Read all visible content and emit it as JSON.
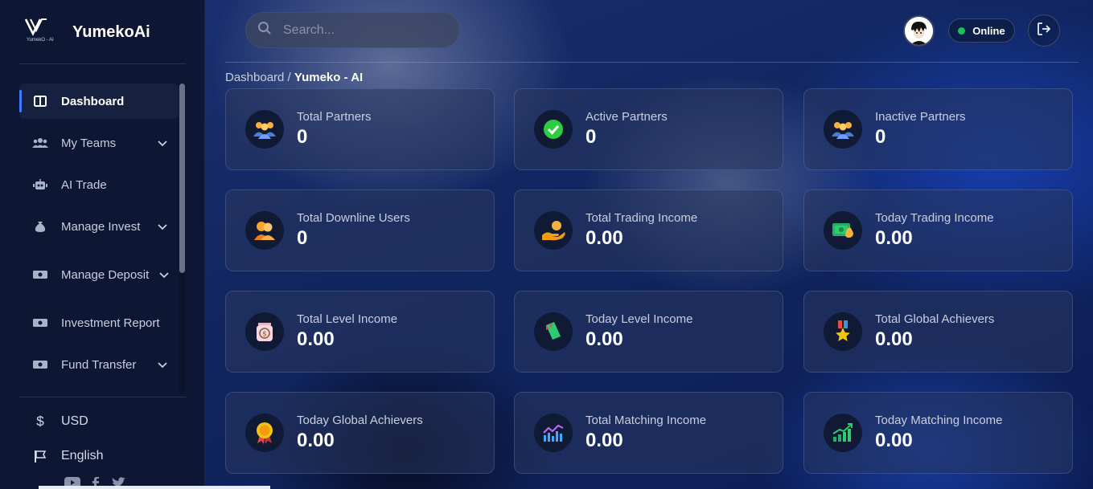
{
  "brand": {
    "name": "YumekoAi",
    "logo_subtext": "YumekO - AI"
  },
  "sidebar": {
    "items": [
      {
        "label": "Dashboard",
        "icon": "dashboard-icon",
        "active": true,
        "expandable": false
      },
      {
        "label": "My Teams",
        "icon": "users-icon",
        "active": false,
        "expandable": true
      },
      {
        "label": "AI Trade",
        "icon": "robot-icon",
        "active": false,
        "expandable": false
      },
      {
        "label": "Manage Invest",
        "icon": "money-bag-icon",
        "active": false,
        "expandable": true
      },
      {
        "label": "Manage Deposit",
        "icon": "money-bill-icon",
        "active": false,
        "expandable": true
      },
      {
        "label": "Investment Report",
        "icon": "money-bill-icon",
        "active": false,
        "expandable": false
      },
      {
        "label": "Fund Transfer",
        "icon": "money-bill-icon",
        "active": false,
        "expandable": true
      }
    ],
    "currency": "USD",
    "language": "English",
    "socials": [
      "youtube-icon",
      "facebook-icon",
      "twitter-icon"
    ]
  },
  "header": {
    "search_placeholder": "Search...",
    "status": "Online"
  },
  "breadcrumb": {
    "root": "Dashboard",
    "separator": " / ",
    "current": "Yumeko - AI"
  },
  "cards": [
    {
      "label": "Total Partners",
      "value": "0",
      "icon": "team-icon"
    },
    {
      "label": "Active Partners",
      "value": "0",
      "icon": "check-icon"
    },
    {
      "label": "Inactive Partners",
      "value": "0",
      "icon": "team-icon"
    },
    {
      "label": "Total Downline Users",
      "value": "0",
      "icon": "downline-users-icon"
    },
    {
      "label": "Total Trading Income",
      "value": "0.00",
      "icon": "hand-coin-icon"
    },
    {
      "label": "Today Trading Income",
      "value": "0.00",
      "icon": "cash-icon"
    },
    {
      "label": "Total Level Income",
      "value": "0.00",
      "icon": "money-bag-icon"
    },
    {
      "label": "Today Level Income",
      "value": "0.00",
      "icon": "ticket-icon"
    },
    {
      "label": "Total Global Achievers",
      "value": "0.00",
      "icon": "medal-icon"
    },
    {
      "label": "Today Global Achievers",
      "value": "0.00",
      "icon": "badge-icon"
    },
    {
      "label": "Total Matching Income",
      "value": "0.00",
      "icon": "bar-chart-icon"
    },
    {
      "label": "Today Matching Income",
      "value": "0.00",
      "icon": "growth-chart-icon"
    }
  ],
  "colors": {
    "accent": "#3f7bff",
    "online": "#16c35a",
    "sidebar_bg": "#0d1733"
  }
}
